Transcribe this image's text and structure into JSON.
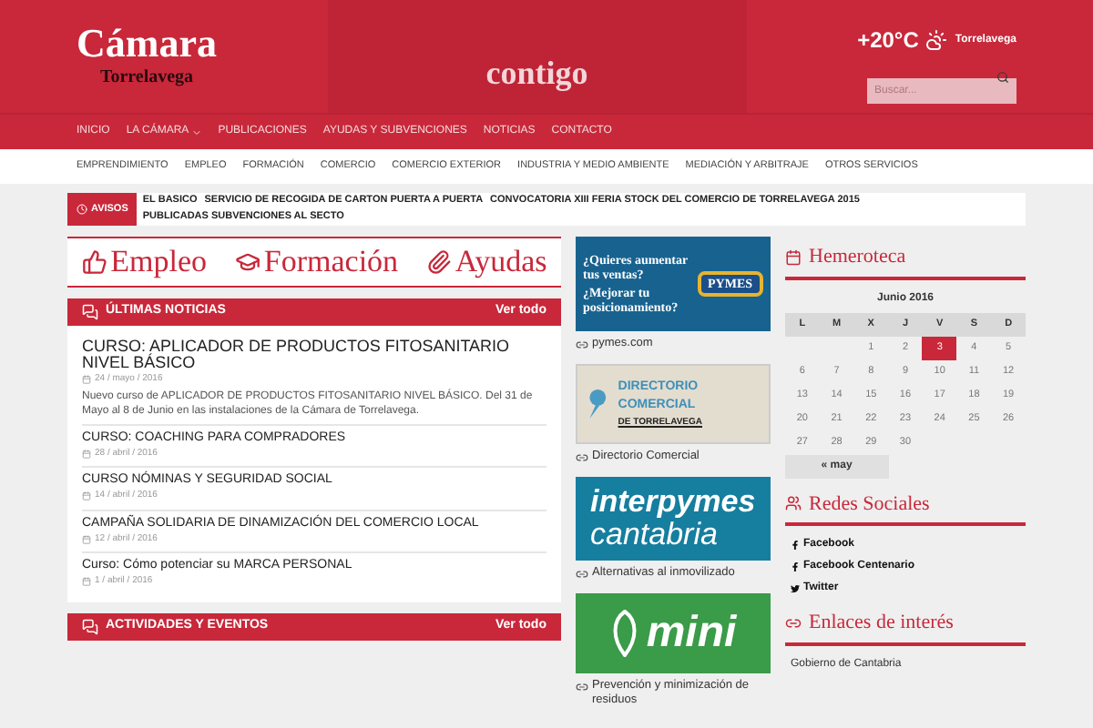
{
  "header": {
    "logo_name": "Cámara",
    "logo_subtitle": "Torrelavega",
    "banner_text": "contigo",
    "weather": {
      "temperature": "+20°C",
      "location": "Torrelavega"
    },
    "search": {
      "placeholder": "Buscar..."
    }
  },
  "main_nav": [
    {
      "label": "INICIO",
      "dropdown": false
    },
    {
      "label": "LA CÁMARA",
      "dropdown": true
    },
    {
      "label": "PUBLICACIONES",
      "dropdown": false
    },
    {
      "label": "AYUDAS Y SUBVENCIONES",
      "dropdown": false
    },
    {
      "label": "NOTICIAS",
      "dropdown": false
    },
    {
      "label": "CONTACTO",
      "dropdown": false
    }
  ],
  "sub_nav": [
    "EMPRENDIMIENTO",
    "EMPLEO",
    "FORMACIÓN",
    "COMERCIO",
    "COMERCIO EXTERIOR",
    "INDUSTRIA Y MEDIO AMBIENTE",
    "MEDIACIÓN Y ARBITRAJE",
    "OTROS SERVICIOS"
  ],
  "ticker": {
    "label": "AVISOS",
    "items": [
      "EL BASICO",
      "SERVICIO DE RECOGIDA DE CARTON PUERTA A PUERTA",
      "CONVOCATORIA XIII FERIA STOCK DEL COMERCIO DE TORRELAVEGA 2015",
      "PUBLICADAS SUBVENCIONES AL SECTO"
    ]
  },
  "quick_links": [
    {
      "label": "Empleo",
      "kind": "thumb"
    },
    {
      "label": "Formación",
      "kind": "cap"
    },
    {
      "label": "Ayudas",
      "kind": "clip"
    }
  ],
  "news": {
    "title": "ÚLTIMAS NOTICIAS",
    "more": "Ver todo",
    "items": [
      {
        "title": "CURSO: APLICADOR DE PRODUCTOS FITOSANITARIO NIVEL BÁSICO",
        "date": "24 / mayo / 2016",
        "excerpt": "Nuevo curso de APLICADOR DE PRODUCTOS FITOSANITARIO NIVEL BÁSICO. Del 31 de Mayo al 8 de Junio en las instalaciones de la Cámara de Torrelavega."
      },
      {
        "title": "CURSO: COACHING PARA COMPRADORES",
        "date": "28 / abril / 2016"
      },
      {
        "title": "CURSO NÓMINAS Y SEGURIDAD SOCIAL",
        "date": "14 / abril / 2016"
      },
      {
        "title": "CAMPAÑA SOLIDARIA DE DINAMIZACIÓN DEL COMERCIO LOCAL",
        "date": "12 / abril / 2016"
      },
      {
        "title": "Curso: Cómo potenciar su MARCA PERSONAL",
        "date": "1 / abril / 2016"
      }
    ]
  },
  "events": {
    "title": "ACTIVIDADES Y EVENTOS",
    "more": "Ver todo"
  },
  "ads": [
    {
      "kind": "pymes",
      "lines": [
        "¿Quieres aumentar tus ventas?",
        "¿Mejorar tu posicionamiento?",
        "PYMES"
      ],
      "caption": "pymes.com"
    },
    {
      "kind": "directorio",
      "lines": [
        "DIRECTORIO COMERCIAL",
        "DE TORRELAVEGA"
      ],
      "caption": "Directorio Comercial"
    },
    {
      "kind": "interpymes",
      "lines": [
        "interpymes",
        "cantabria"
      ],
      "caption": "Alternativas al inmovilizado"
    },
    {
      "kind": "mini",
      "lines": [
        "mini"
      ],
      "caption": "Prevención y minimización de residuos"
    }
  ],
  "hemeroteca": {
    "title": "Hemeroteca",
    "month": "Junio 2016",
    "weekdays": [
      "L",
      "M",
      "X",
      "J",
      "V",
      "S",
      "D"
    ],
    "weeks": [
      {
        "days": [
          {
            "kind": "blank"
          },
          {
            "kind": "blank"
          },
          {
            "kind": "day",
            "day": "1",
            "selected": false
          },
          {
            "kind": "day",
            "day": "2",
            "selected": false
          },
          {
            "kind": "day",
            "day": "3",
            "selected": true
          },
          {
            "kind": "day",
            "day": "4",
            "selected": false
          },
          {
            "kind": "day",
            "day": "5",
            "selected": false
          }
        ]
      },
      {
        "days": [
          {
            "kind": "day",
            "day": "6",
            "selected": false
          },
          {
            "kind": "day",
            "day": "7",
            "selected": false
          },
          {
            "kind": "day",
            "day": "8",
            "selected": false
          },
          {
            "kind": "day",
            "day": "9",
            "selected": false
          },
          {
            "kind": "day",
            "day": "10",
            "selected": false
          },
          {
            "kind": "day",
            "day": "11",
            "selected": false
          },
          {
            "kind": "day",
            "day": "12",
            "selected": false
          }
        ]
      },
      {
        "days": [
          {
            "kind": "day",
            "day": "13",
            "selected": false
          },
          {
            "kind": "day",
            "day": "14",
            "selected": false
          },
          {
            "kind": "day",
            "day": "15",
            "selected": false
          },
          {
            "kind": "day",
            "day": "16",
            "selected": false
          },
          {
            "kind": "day",
            "day": "17",
            "selected": false
          },
          {
            "kind": "day",
            "day": "18",
            "selected": false
          },
          {
            "kind": "day",
            "day": "19",
            "selected": false
          }
        ]
      },
      {
        "days": [
          {
            "kind": "day",
            "day": "20",
            "selected": false
          },
          {
            "kind": "day",
            "day": "21",
            "selected": false
          },
          {
            "kind": "day",
            "day": "22",
            "selected": false
          },
          {
            "kind": "day",
            "day": "23",
            "selected": false
          },
          {
            "kind": "day",
            "day": "24",
            "selected": false
          },
          {
            "kind": "day",
            "day": "25",
            "selected": false
          },
          {
            "kind": "day",
            "day": "26",
            "selected": false
          }
        ]
      },
      {
        "days": [
          {
            "kind": "day",
            "day": "27",
            "selected": false
          },
          {
            "kind": "day",
            "day": "28",
            "selected": false
          },
          {
            "kind": "day",
            "day": "29",
            "selected": false
          },
          {
            "kind": "day",
            "day": "30",
            "selected": false
          }
        ]
      }
    ],
    "prev": "« may"
  },
  "social": {
    "title": "Redes Sociales",
    "links": [
      {
        "label": "Facebook",
        "kind": "facebook"
      },
      {
        "label": "Facebook Centenario",
        "kind": "facebook"
      },
      {
        "label": "Twitter",
        "kind": "twitter"
      }
    ]
  },
  "links": {
    "title": "Enlaces de interés",
    "items": [
      "Gobierno de Cantabria"
    ]
  }
}
